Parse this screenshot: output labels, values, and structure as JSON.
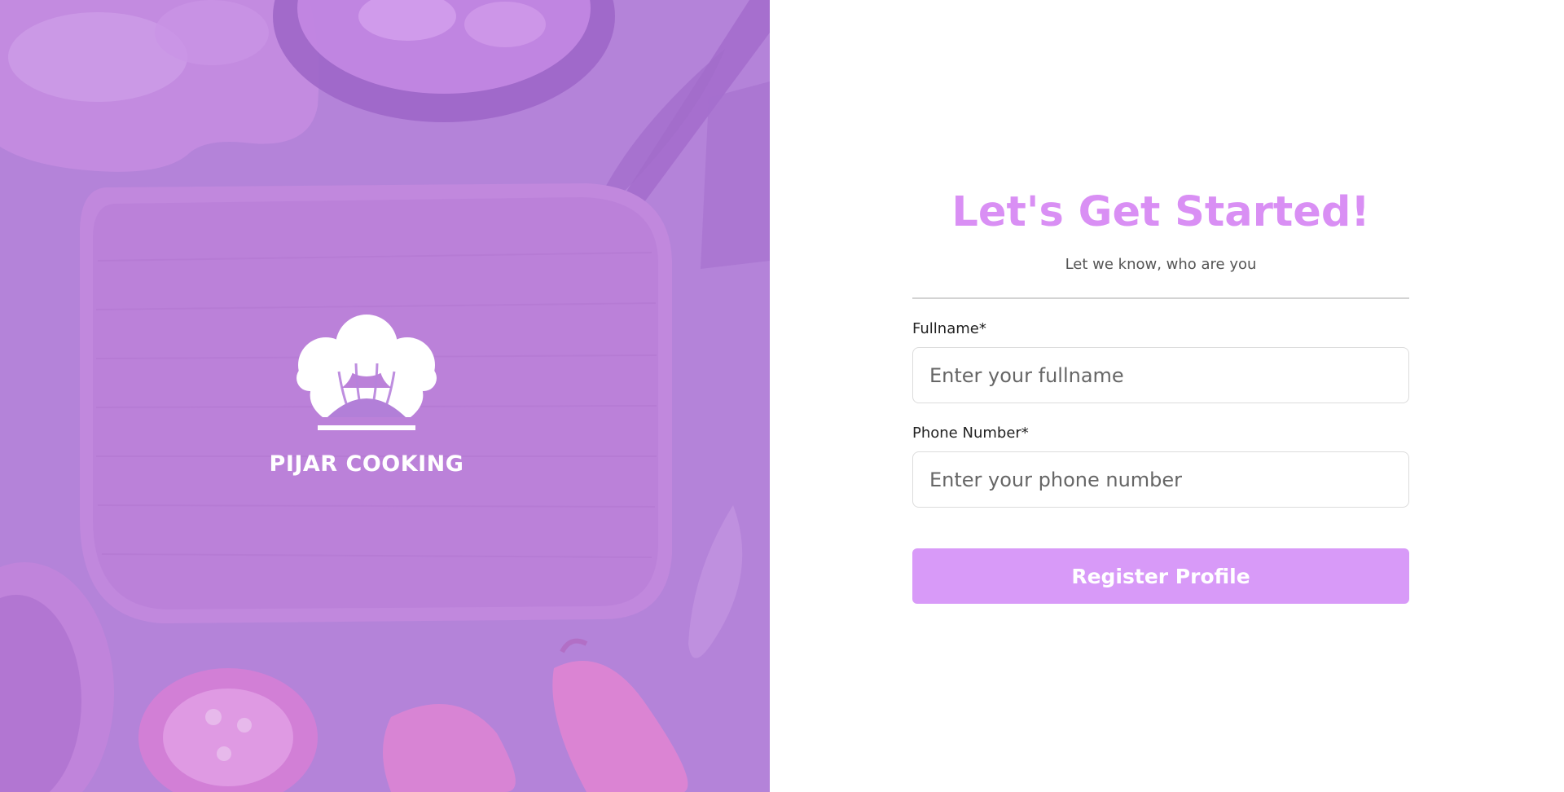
{
  "brand": {
    "name": "PIJAR COOKING",
    "logo_icon": "chef-hat-icon"
  },
  "form": {
    "title": "Let's Get Started!",
    "subtitle": "Let we know, who are you",
    "fullname_label": "Fullname*",
    "fullname_placeholder": "Enter your fullname",
    "fullname_value": "",
    "phone_label": "Phone Number*",
    "phone_placeholder": "Enter your phone number",
    "phone_value": "",
    "submit_label": "Register Profile"
  },
  "colors": {
    "accent": "#d89af8",
    "title": "#d98ff4",
    "hero_overlay": "#b07fd8"
  }
}
